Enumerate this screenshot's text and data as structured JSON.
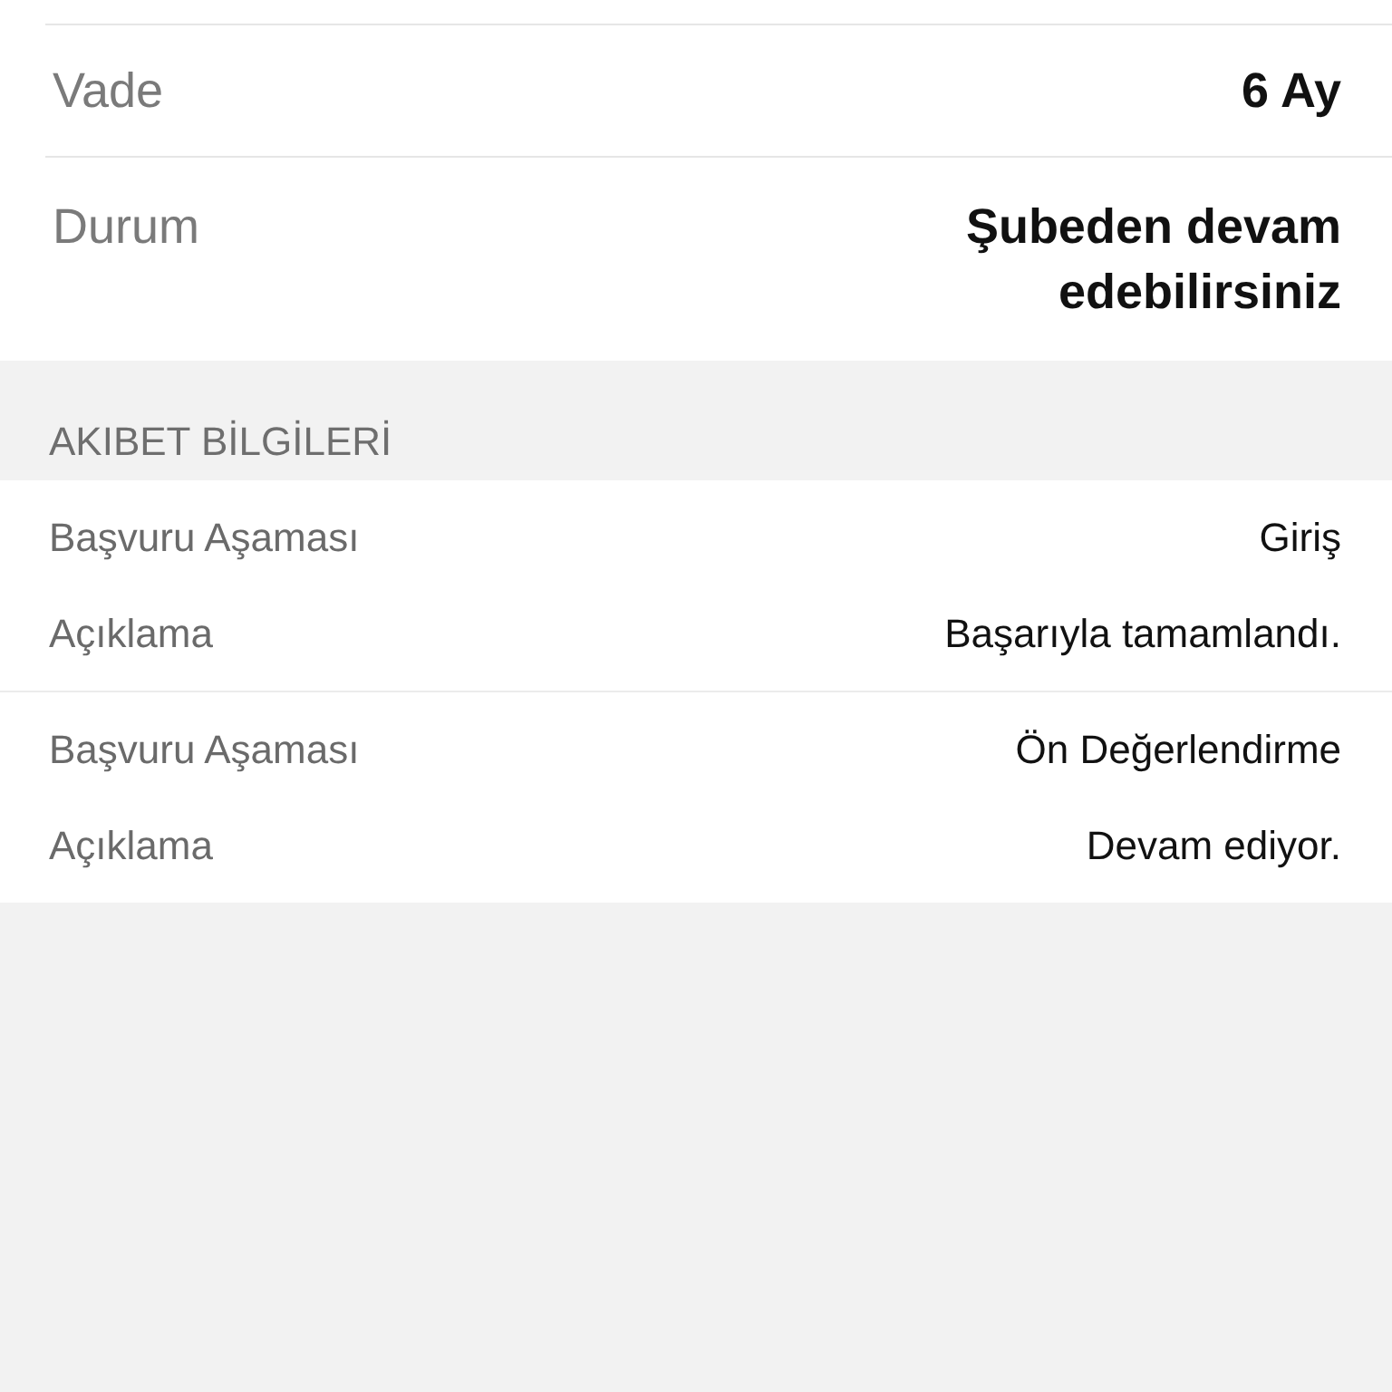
{
  "details": [
    {
      "label": "Vade",
      "value": "6 Ay"
    },
    {
      "label": "Durum",
      "value": "Şubeden devam edebilirsiniz"
    }
  ],
  "section_title": "AKIBET BİLGİLERİ",
  "stages": [
    {
      "rows": [
        {
          "label": "Başvuru Aşaması",
          "value": "Giriş"
        },
        {
          "label": "Açıklama",
          "value": "Başarıyla tamamlandı."
        }
      ]
    },
    {
      "rows": [
        {
          "label": "Başvuru Aşaması",
          "value": "Ön Değerlendirme"
        },
        {
          "label": "Açıklama",
          "value": "Devam ediyor."
        }
      ]
    }
  ]
}
